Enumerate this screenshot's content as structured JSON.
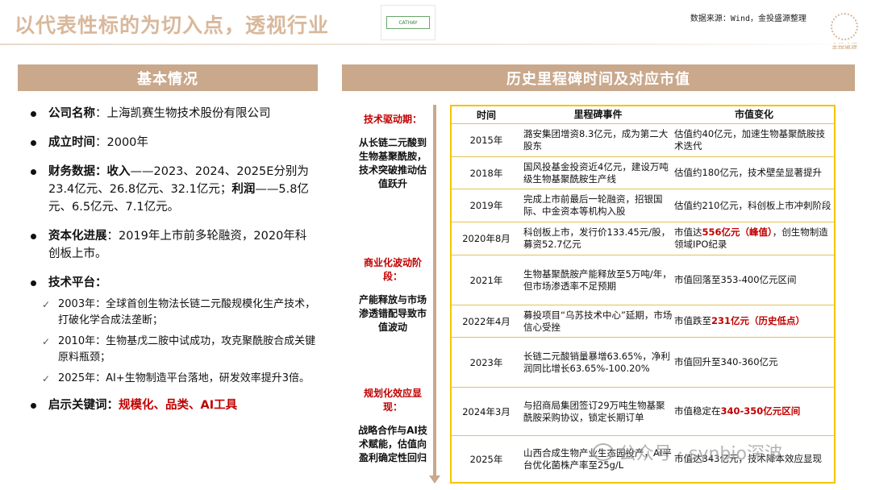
{
  "header": {
    "title": "以代表性标的为切入点，透视行业",
    "logo_text": "CATHAY",
    "source": "数据来源：Wind，金投盛源整理",
    "brand": "金投盛源"
  },
  "left_panel": {
    "heading": "基本情况",
    "company_label": "公司名称",
    "company_value": "：上海凯赛生物技术股份有限公司",
    "founded_label": "成立时间",
    "founded_value": "：2000年",
    "finance_label": "财务数据：",
    "revenue_label": "收入",
    "revenue_value": "——2023、2024、2025E分别为23.4亿元、26.8亿元、32.1亿元；",
    "profit_label": "利润",
    "profit_value": "——5.8亿元、6.5亿元、7.1亿元。",
    "capital_label": "资本化进展",
    "capital_value": "：2019年上市前多轮融资，2020年科创板上市。",
    "tech_label": "技术平台：",
    "tech_items": [
      "2003年：全球首创生物法长链二元酸规模化生产技术，打破化学合成法垄断；",
      "2010年：生物基戊二胺中试成功，攻克聚酰胺合成关键原料瓶颈；",
      "2025年：AI+生物制造平台落地，研发效率提升3倍。"
    ],
    "keywords_label": "启示关键词：",
    "keywords_value": "规模化、品类、AI工具"
  },
  "right_panel": {
    "heading": "历史里程碑时间及对应市值",
    "phases": [
      {
        "title": "技术驱动期：",
        "desc": "从长链二元酸到生物基聚酰胺，技术突破推动估值跃升"
      },
      {
        "title": "商业化波动阶段：",
        "desc": "产能释放与市场渗透错配导致市值波动"
      },
      {
        "title": "规划化效应显现：",
        "desc": "战略合作与AI技术赋能，估值向盈利确定性回归"
      }
    ],
    "columns": [
      "时间",
      "里程碑事件",
      "市值变化"
    ],
    "rows": [
      {
        "time": "2015年",
        "event": "潞安集团增资8.3亿元，成为第二大股东",
        "value_pre": "估值约40亿元，加速生物基聚酰胺技术迭代",
        "value_red": "",
        "value_post": ""
      },
      {
        "time": "2018年",
        "event": "国风投基金投资近4亿元，建设万吨级生物基聚酰胺生产线",
        "value_pre": "估值约180亿元，技术壁垒显著提升",
        "value_red": "",
        "value_post": ""
      },
      {
        "time": "2019年",
        "event": "完成上市前最后一轮融资，招银国际、中金资本等机构入股",
        "value_pre": "估值约210亿元，科创板上市冲刺阶段",
        "value_red": "",
        "value_post": ""
      },
      {
        "time": "2020年8月",
        "event": "科创板上市，发行价133.45元/股，募资52.7亿元",
        "value_pre": "市值达",
        "value_red": "556亿元（峰值）",
        "value_post": "，创生物制造领域IPO纪录"
      },
      {
        "time": "2021年",
        "event": "生物基聚酰胺产能释放至5万吨/年，但市场渗透率不足预期",
        "value_pre": "市值回落至353-400亿元区间",
        "value_red": "",
        "value_post": ""
      },
      {
        "time": "2022年4月",
        "event": "募投项目“乌苏技术中心”延期，市场信心受挫",
        "value_pre": "市值跌至",
        "value_red": "231亿元（历史低点）",
        "value_post": ""
      },
      {
        "time": "2023年",
        "event": "长链二元酸销量暴增63.65%，净利润同比增长63.65%-100.20%",
        "value_pre": "市值回升至340-360亿元",
        "value_red": "",
        "value_post": ""
      },
      {
        "time": "2024年3月",
        "event": "与招商局集团签订29万吨生物基聚酰胺采购协议，锁定长期订单",
        "value_pre": "市值稳定在",
        "value_red": "340-350亿元区间",
        "value_post": ""
      },
      {
        "time": "2025年",
        "event": "山西合成生物产业生态园投产，AI平台优化菌株产率至25g/L",
        "value_pre": "市值达343亿元，技术降本效应显现",
        "value_red": "",
        "value_post": ""
      }
    ]
  },
  "watermark": "公众号 · synbio深波"
}
